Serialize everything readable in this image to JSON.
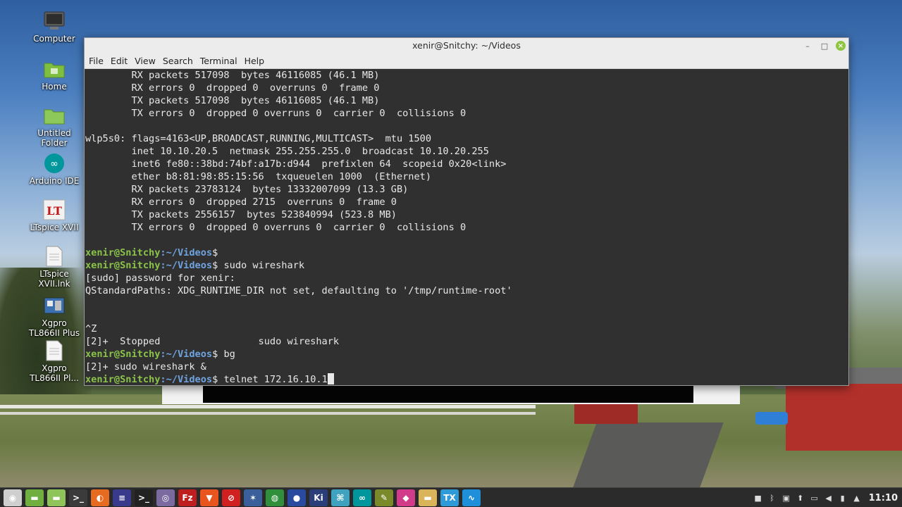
{
  "desktop": {
    "icons": [
      {
        "label": "Computer",
        "icon": "computer-icon"
      },
      {
        "label": "Home",
        "icon": "home-folder-icon"
      },
      {
        "label": "Untitled Folder",
        "icon": "folder-icon"
      },
      {
        "label": "Arduino IDE",
        "icon": "arduino-icon"
      },
      {
        "label": "LTspice XVII",
        "icon": "ltspice-icon"
      },
      {
        "label": "LTspice XVII.lnk",
        "icon": "file-icon"
      },
      {
        "label": "Xgpro TL866II Plus",
        "icon": "xgpro-icon"
      },
      {
        "label": "Xgpro TL866II Pl...",
        "icon": "file-icon"
      }
    ]
  },
  "window": {
    "title": "xenir@Snitchy: ~/Videos",
    "controls": {
      "minimize": "–",
      "maximize": "□",
      "close": "×"
    }
  },
  "menu": [
    "File",
    "Edit",
    "View",
    "Search",
    "Terminal",
    "Help"
  ],
  "terminal": {
    "prompt_user": "xenir@Snitchy",
    "prompt_path": ":~/Videos",
    "prompt_sign": "$",
    "lines": [
      "        RX packets 517098  bytes 46116085 (46.1 MB)",
      "        RX errors 0  dropped 0  overruns 0  frame 0",
      "        TX packets 517098  bytes 46116085 (46.1 MB)",
      "        TX errors 0  dropped 0 overruns 0  carrier 0  collisions 0",
      "",
      "wlp5s0: flags=4163<UP,BROADCAST,RUNNING,MULTICAST>  mtu 1500",
      "        inet 10.10.20.5  netmask 255.255.255.0  broadcast 10.10.20.255",
      "        inet6 fe80::38bd:74bf:a17b:d944  prefixlen 64  scopeid 0x20<link>",
      "        ether b8:81:98:85:15:56  txqueuelen 1000  (Ethernet)",
      "        RX packets 23783124  bytes 13332007099 (13.3 GB)",
      "        RX errors 0  dropped 2715  overruns 0  frame 0",
      "        TX packets 2556157  bytes 523840994 (523.8 MB)",
      "        TX errors 0  dropped 0 overruns 0  carrier 0  collisions 0",
      ""
    ],
    "prompt_1_cmd": "",
    "prompt_2_cmd": " sudo wireshark",
    "out_1": "[sudo] password for xenir:",
    "out_2": "QStandardPaths: XDG_RUNTIME_DIR not set, defaulting to '/tmp/runtime-root'",
    "out_3": "",
    "out_4": "",
    "out_5": "^Z",
    "out_6": "[2]+  Stopped                 sudo wireshark",
    "prompt_3_cmd": " bg",
    "out_7": "[2]+ sudo wireshark &",
    "prompt_4_cmd": " telnet 172.16.10.1"
  },
  "taskbar": {
    "apps": [
      {
        "icon": "mint-menu-icon",
        "glyph": "◉",
        "color": "#cfcfcf"
      },
      {
        "icon": "show-desktop-icon",
        "glyph": "▬",
        "color": "#6fae3f"
      },
      {
        "icon": "files-icon",
        "glyph": "▬",
        "color": "#8fc45a"
      },
      {
        "icon": "terminal-icon",
        "glyph": ">_",
        "color": "#3b3b3b"
      },
      {
        "icon": "firefox-icon",
        "glyph": "◐",
        "color": "#e66a1f"
      },
      {
        "icon": "eclipse-icon",
        "glyph": "≡",
        "color": "#3a3a8c"
      },
      {
        "icon": "terminal-2-icon",
        "glyph": ">_",
        "color": "#222222"
      },
      {
        "icon": "screenshot-icon",
        "glyph": "◎",
        "color": "#7a6aa0"
      },
      {
        "icon": "filezilla-icon",
        "glyph": "Fz",
        "color": "#bf1e1e"
      },
      {
        "icon": "brave-icon",
        "glyph": "▼",
        "color": "#e8551e"
      },
      {
        "icon": "stop-icon",
        "glyph": "⊘",
        "color": "#d02020"
      },
      {
        "icon": "kicad-icon",
        "glyph": "✶",
        "color": "#3a5f9a"
      },
      {
        "icon": "globe-icon",
        "glyph": "◍",
        "color": "#2f8f3a"
      },
      {
        "icon": "privacy-icon",
        "glyph": "●",
        "color": "#2a4aa0"
      },
      {
        "icon": "kicad-ki-icon",
        "glyph": "Ki",
        "color": "#2c3e7a"
      },
      {
        "icon": "network-icon",
        "glyph": "⌘",
        "color": "#3fa3c0"
      },
      {
        "icon": "arduino-task-icon",
        "glyph": "∞",
        "color": "#00979c"
      },
      {
        "icon": "tools-icon",
        "glyph": "✎",
        "color": "#7a8a2a"
      },
      {
        "icon": "wireshark-icon",
        "glyph": "◆",
        "color": "#d23a8a"
      },
      {
        "icon": "folder-task-icon",
        "glyph": "▬",
        "color": "#d9b45a"
      },
      {
        "icon": "tx-icon",
        "glyph": "TX",
        "color": "#2f9ad8"
      },
      {
        "icon": "wave-icon",
        "glyph": "∿",
        "color": "#1e8fd8"
      }
    ],
    "tray": [
      {
        "icon": "camera-tray-icon",
        "glyph": "■"
      },
      {
        "icon": "bluetooth-tray-icon",
        "glyph": "ᛒ"
      },
      {
        "icon": "clipboard-tray-icon",
        "glyph": "▣"
      },
      {
        "icon": "update-tray-icon",
        "glyph": "⬆"
      },
      {
        "icon": "network-tray-icon",
        "glyph": "▭"
      },
      {
        "icon": "volume-tray-icon",
        "glyph": "◀"
      },
      {
        "icon": "power-tray-icon",
        "glyph": "▮"
      },
      {
        "icon": "settings-tray-icon",
        "glyph": "▲"
      }
    ],
    "clock": "11:10"
  }
}
